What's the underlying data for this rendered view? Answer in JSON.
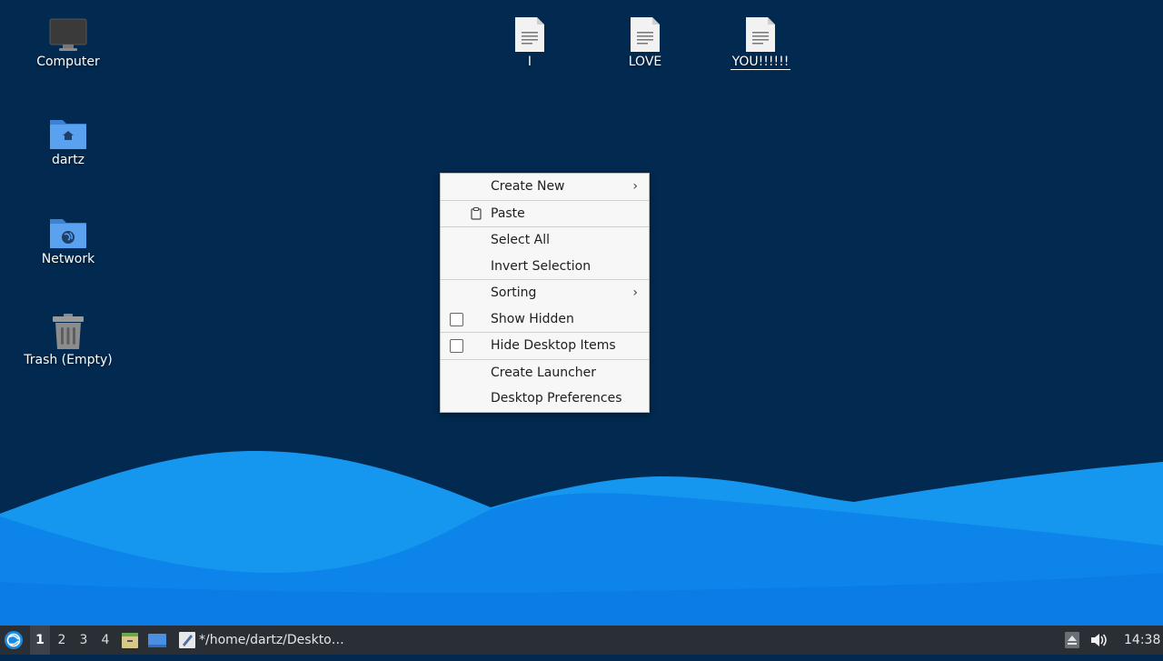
{
  "desktop_icons": {
    "computer": "Computer",
    "home": "dartz",
    "network": "Network",
    "trash": "Trash (Empty)",
    "file1": "I",
    "file2": "LOVE",
    "file3": "YOU!!!!!!"
  },
  "menu": {
    "create_new": "Create New",
    "paste": "Paste",
    "select_all": "Select All",
    "invert_selection": "Invert Selection",
    "sorting": "Sorting",
    "show_hidden": "Show Hidden",
    "hide_desktop_items": "Hide Desktop Items",
    "create_launcher": "Create Launcher",
    "desktop_preferences": "Desktop Preferences"
  },
  "taskbar": {
    "workspaces": [
      "1",
      "2",
      "3",
      "4"
    ],
    "active_workspace": "1",
    "task_title": "*/home/dartz/Deskto…",
    "clock": "14:38"
  },
  "colors": {
    "desktop_bg": "#02294f",
    "wave_light": "#1aa0f5",
    "wave_mid": "#0d84ea",
    "wave_dark": "#0a6fdc",
    "taskbar_bg": "#2a2f36"
  }
}
